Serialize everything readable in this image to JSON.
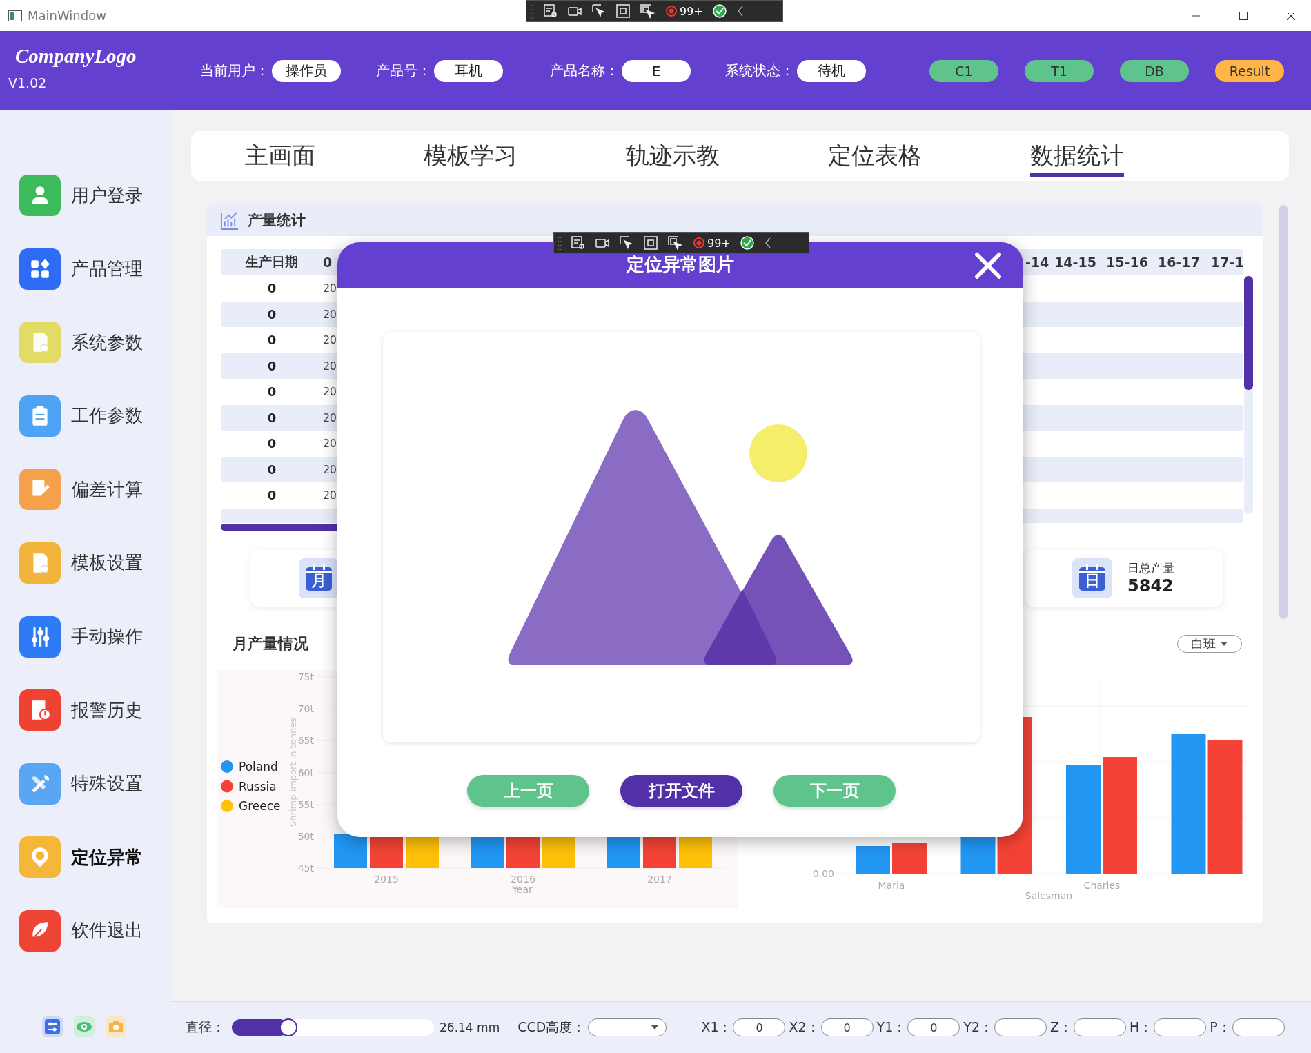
{
  "window": {
    "title": "MainWindow"
  },
  "debug_toolbars": [
    {
      "count": "99+"
    },
    {
      "count": "99+"
    }
  ],
  "header": {
    "logo": "CompanyLogo",
    "version": "V1.02",
    "fields": [
      {
        "label": "当前用户：",
        "value": "操作员"
      },
      {
        "label": "产品号：",
        "value": "耳机"
      },
      {
        "label": "产品名称：",
        "value": "E"
      },
      {
        "label": "系统状态：",
        "value": "待机"
      }
    ],
    "status": [
      {
        "label": "C1",
        "color": "#5ec48b"
      },
      {
        "label": "T1",
        "color": "#5ec48b"
      },
      {
        "label": "DB",
        "color": "#5ec48b"
      },
      {
        "label": "Result",
        "color": "#ffb547"
      }
    ]
  },
  "sidebar": {
    "items": [
      {
        "label": "用户登录",
        "color": "#3dbb5a",
        "selected": false
      },
      {
        "label": "产品管理",
        "color": "#2f6cf5",
        "selected": false
      },
      {
        "label": "系统参数",
        "color": "#e2db66",
        "selected": false
      },
      {
        "label": "工作参数",
        "color": "#4fa3f5",
        "selected": false
      },
      {
        "label": "偏差计算",
        "color": "#f5a04b",
        "selected": false
      },
      {
        "label": "模板设置",
        "color": "#f2b43a",
        "selected": false
      },
      {
        "label": "手动操作",
        "color": "#2f7af5",
        "selected": false
      },
      {
        "label": "报警历史",
        "color": "#ef4232",
        "selected": false
      },
      {
        "label": "特殊设置",
        "color": "#5aa6f4",
        "selected": false
      },
      {
        "label": "定位异常",
        "color": "#f4b73a",
        "selected": true
      },
      {
        "label": "软件退出",
        "color": "#ee4433",
        "selected": false
      }
    ]
  },
  "tabs": [
    {
      "label": "主画面",
      "selected": false
    },
    {
      "label": "模板学习",
      "selected": false
    },
    {
      "label": "轨迹示教",
      "selected": false
    },
    {
      "label": "定位表格",
      "selected": false
    },
    {
      "label": "数据统计",
      "selected": true
    }
  ],
  "production": {
    "title": "产量统计",
    "table": {
      "columns": [
        "生产日期",
        "0",
        "-14",
        "14-15",
        "15-16",
        "16-17",
        "17-1"
      ],
      "rows": [
        [
          "0",
          "20"
        ],
        [
          "0",
          "20"
        ],
        [
          "0",
          "20"
        ],
        [
          "0",
          "20"
        ],
        [
          "0",
          "20"
        ],
        [
          "0",
          "20"
        ],
        [
          "0",
          "20"
        ],
        [
          "0",
          "20"
        ],
        [
          "0",
          "20"
        ]
      ]
    },
    "cards": [
      {
        "icon_text": "月"
      },
      {
        "icon_text": "日",
        "title": "日总产量",
        "value": "5842"
      }
    ],
    "monthly_title": "月产量情况",
    "shift": "白班",
    "left_chart": {
      "legend": [
        {
          "name": "Poland",
          "color": "#2196f3"
        },
        {
          "name": "Russia",
          "color": "#f44336"
        },
        {
          "name": "Greece",
          "color": "#ffc107"
        }
      ],
      "ylabel": "Shrimp import in tonnes",
      "yticks": [
        "75t",
        "70t",
        "65t",
        "60t",
        "55t",
        "50t",
        "45t"
      ],
      "categories": [
        "2015",
        "2016",
        "2017"
      ],
      "xlabel": "Year"
    },
    "right_chart": {
      "ytick": "0.00",
      "category_labels": [
        "Maria",
        "Charles"
      ],
      "xlabel": "Salesman"
    }
  },
  "dialog": {
    "title": "定位异常图片",
    "buttons": [
      {
        "label": "上一页",
        "kind": "secondary"
      },
      {
        "label": "打开文件",
        "kind": "primary"
      },
      {
        "label": "下一页",
        "kind": "secondary"
      }
    ]
  },
  "bottom_bar": {
    "diameter": {
      "label": "直径：",
      "level": 0.28,
      "reading": "26.14 mm"
    },
    "ccd": {
      "label": "CCD高度："
    },
    "coords": [
      {
        "label": "X1：",
        "value": "0"
      },
      {
        "label": "X2：",
        "value": "0"
      },
      {
        "label": "Y1：",
        "value": "0"
      },
      {
        "label": "Y2："
      },
      {
        "label": "Z："
      },
      {
        "label": "H："
      },
      {
        "label": "P："
      }
    ]
  }
}
